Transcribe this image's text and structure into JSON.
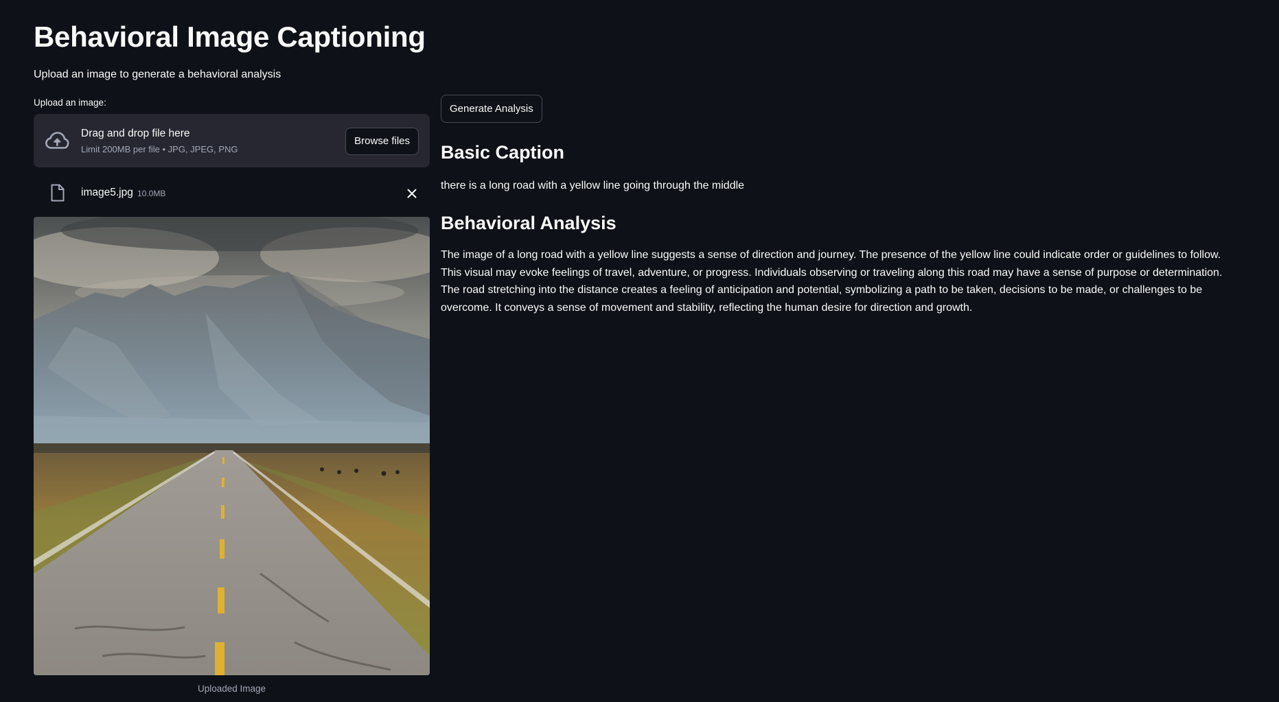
{
  "header": {
    "title": "Behavioral Image Captioning",
    "subtitle": "Upload an image to generate a behavioral analysis"
  },
  "uploader": {
    "label": "Upload an image:",
    "dropzone_title": "Drag and drop file here",
    "dropzone_limit": "Limit 200MB per file • JPG, JPEG, PNG",
    "browse_label": "Browse files",
    "icon": "cloud-upload-icon"
  },
  "uploaded_file": {
    "name": "image5.jpg",
    "size": "10.0MB",
    "icon": "file-icon",
    "remove_icon": "close-icon"
  },
  "preview": {
    "caption": "Uploaded Image"
  },
  "actions": {
    "generate_label": "Generate Analysis"
  },
  "results": {
    "basic_caption_heading": "Basic Caption",
    "basic_caption_text": "there is a long road with a yellow line going through the middle",
    "behavioral_heading": "Behavioral Analysis",
    "behavioral_text": "The image of a long road with a yellow line suggests a sense of direction and journey. The presence of the yellow line could indicate order or guidelines to follow. This visual may evoke feelings of travel, adventure, or progress. Individuals observing or traveling along this road may have a sense of purpose or determination. The road stretching into the distance creates a feeling of anticipation and potential, symbolizing a path to be taken, decisions to be made, or challenges to be overcome. It conveys a sense of movement and stability, reflecting the human desire for direction and growth."
  },
  "colors": {
    "background": "#0e1117",
    "dropzone_bg": "#262730",
    "text": "#fafafa",
    "muted_text": "#a3a8b8",
    "button_border": "#494b57"
  }
}
